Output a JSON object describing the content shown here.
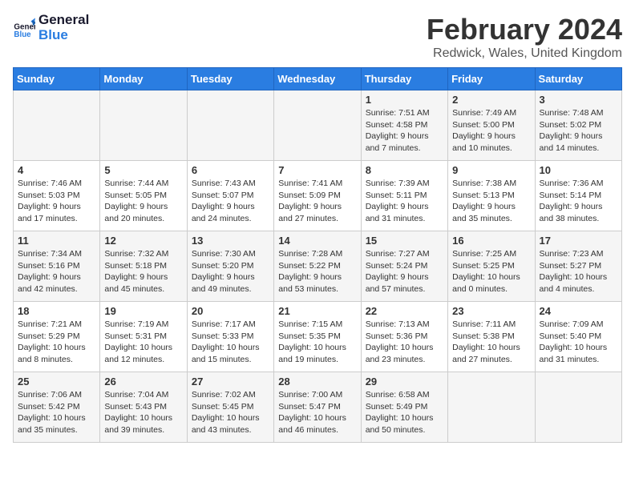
{
  "header": {
    "logo_line1": "General",
    "logo_line2": "Blue",
    "title": "February 2024",
    "subtitle": "Redwick, Wales, United Kingdom"
  },
  "weekdays": [
    "Sunday",
    "Monday",
    "Tuesday",
    "Wednesday",
    "Thursday",
    "Friday",
    "Saturday"
  ],
  "weeks": [
    [
      {
        "day": "",
        "content": ""
      },
      {
        "day": "",
        "content": ""
      },
      {
        "day": "",
        "content": ""
      },
      {
        "day": "",
        "content": ""
      },
      {
        "day": "1",
        "content": "Sunrise: 7:51 AM\nSunset: 4:58 PM\nDaylight: 9 hours\nand 7 minutes."
      },
      {
        "day": "2",
        "content": "Sunrise: 7:49 AM\nSunset: 5:00 PM\nDaylight: 9 hours\nand 10 minutes."
      },
      {
        "day": "3",
        "content": "Sunrise: 7:48 AM\nSunset: 5:02 PM\nDaylight: 9 hours\nand 14 minutes."
      }
    ],
    [
      {
        "day": "4",
        "content": "Sunrise: 7:46 AM\nSunset: 5:03 PM\nDaylight: 9 hours\nand 17 minutes."
      },
      {
        "day": "5",
        "content": "Sunrise: 7:44 AM\nSunset: 5:05 PM\nDaylight: 9 hours\nand 20 minutes."
      },
      {
        "day": "6",
        "content": "Sunrise: 7:43 AM\nSunset: 5:07 PM\nDaylight: 9 hours\nand 24 minutes."
      },
      {
        "day": "7",
        "content": "Sunrise: 7:41 AM\nSunset: 5:09 PM\nDaylight: 9 hours\nand 27 minutes."
      },
      {
        "day": "8",
        "content": "Sunrise: 7:39 AM\nSunset: 5:11 PM\nDaylight: 9 hours\nand 31 minutes."
      },
      {
        "day": "9",
        "content": "Sunrise: 7:38 AM\nSunset: 5:13 PM\nDaylight: 9 hours\nand 35 minutes."
      },
      {
        "day": "10",
        "content": "Sunrise: 7:36 AM\nSunset: 5:14 PM\nDaylight: 9 hours\nand 38 minutes."
      }
    ],
    [
      {
        "day": "11",
        "content": "Sunrise: 7:34 AM\nSunset: 5:16 PM\nDaylight: 9 hours\nand 42 minutes."
      },
      {
        "day": "12",
        "content": "Sunrise: 7:32 AM\nSunset: 5:18 PM\nDaylight: 9 hours\nand 45 minutes."
      },
      {
        "day": "13",
        "content": "Sunrise: 7:30 AM\nSunset: 5:20 PM\nDaylight: 9 hours\nand 49 minutes."
      },
      {
        "day": "14",
        "content": "Sunrise: 7:28 AM\nSunset: 5:22 PM\nDaylight: 9 hours\nand 53 minutes."
      },
      {
        "day": "15",
        "content": "Sunrise: 7:27 AM\nSunset: 5:24 PM\nDaylight: 9 hours\nand 57 minutes."
      },
      {
        "day": "16",
        "content": "Sunrise: 7:25 AM\nSunset: 5:25 PM\nDaylight: 10 hours\nand 0 minutes."
      },
      {
        "day": "17",
        "content": "Sunrise: 7:23 AM\nSunset: 5:27 PM\nDaylight: 10 hours\nand 4 minutes."
      }
    ],
    [
      {
        "day": "18",
        "content": "Sunrise: 7:21 AM\nSunset: 5:29 PM\nDaylight: 10 hours\nand 8 minutes."
      },
      {
        "day": "19",
        "content": "Sunrise: 7:19 AM\nSunset: 5:31 PM\nDaylight: 10 hours\nand 12 minutes."
      },
      {
        "day": "20",
        "content": "Sunrise: 7:17 AM\nSunset: 5:33 PM\nDaylight: 10 hours\nand 15 minutes."
      },
      {
        "day": "21",
        "content": "Sunrise: 7:15 AM\nSunset: 5:35 PM\nDaylight: 10 hours\nand 19 minutes."
      },
      {
        "day": "22",
        "content": "Sunrise: 7:13 AM\nSunset: 5:36 PM\nDaylight: 10 hours\nand 23 minutes."
      },
      {
        "day": "23",
        "content": "Sunrise: 7:11 AM\nSunset: 5:38 PM\nDaylight: 10 hours\nand 27 minutes."
      },
      {
        "day": "24",
        "content": "Sunrise: 7:09 AM\nSunset: 5:40 PM\nDaylight: 10 hours\nand 31 minutes."
      }
    ],
    [
      {
        "day": "25",
        "content": "Sunrise: 7:06 AM\nSunset: 5:42 PM\nDaylight: 10 hours\nand 35 minutes."
      },
      {
        "day": "26",
        "content": "Sunrise: 7:04 AM\nSunset: 5:43 PM\nDaylight: 10 hours\nand 39 minutes."
      },
      {
        "day": "27",
        "content": "Sunrise: 7:02 AM\nSunset: 5:45 PM\nDaylight: 10 hours\nand 43 minutes."
      },
      {
        "day": "28",
        "content": "Sunrise: 7:00 AM\nSunset: 5:47 PM\nDaylight: 10 hours\nand 46 minutes."
      },
      {
        "day": "29",
        "content": "Sunrise: 6:58 AM\nSunset: 5:49 PM\nDaylight: 10 hours\nand 50 minutes."
      },
      {
        "day": "",
        "content": ""
      },
      {
        "day": "",
        "content": ""
      }
    ]
  ]
}
